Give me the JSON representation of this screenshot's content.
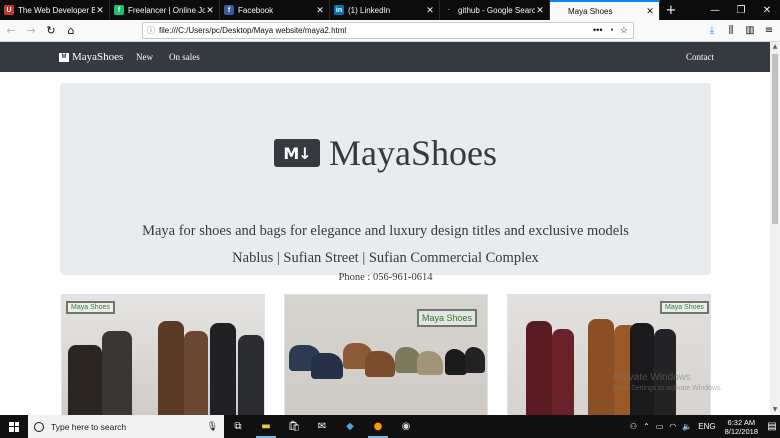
{
  "browser": {
    "tabs": [
      {
        "title": "The Web Developer Boo",
        "icon": "udemy-icon",
        "active": false
      },
      {
        "title": "Freelancer | Online Jobs",
        "icon": "freelancer-icon",
        "active": false
      },
      {
        "title": "Facebook",
        "icon": "facebook-icon",
        "active": false
      },
      {
        "title": "(1) LinkedIn",
        "icon": "linkedin-icon",
        "active": false
      },
      {
        "title": "github - Google Search",
        "icon": "search-icon",
        "active": false
      },
      {
        "title": "Maya Shoes",
        "icon": "page-icon",
        "active": true
      }
    ],
    "url": "file:///C:/Users/pc/Desktop/Maya website/maya2.html",
    "accent_color": "#0a84ff"
  },
  "site": {
    "brand": "MayaShoes",
    "brand_mark": "M",
    "nav": {
      "new": "New",
      "sales": "On sales",
      "contact": "Contact"
    },
    "nav_bg": "#343a40",
    "hero": {
      "logo_glyph": "M↓",
      "title": "MayaShoes",
      "tagline": "Maya for shoes and bags for elegance and luxury design titles and exclusive models",
      "address": "Nablus | Sufian Street | Sufian Commercial Complex",
      "phone": "Phone : 056-961-0614",
      "bg": "#e9ecef"
    },
    "cards": [
      {
        "tag": "Maya Shoes"
      },
      {
        "tag": "Maya Shoes"
      },
      {
        "tag": "Maya Shoes"
      }
    ]
  },
  "windows_watermark": {
    "line1": "Activate Windows",
    "line2": "Go to Settings to activate Windows."
  },
  "taskbar": {
    "search_placeholder": "Type here to search",
    "language": "ENG",
    "time": "6:32 AM",
    "date": "8/12/2018"
  }
}
